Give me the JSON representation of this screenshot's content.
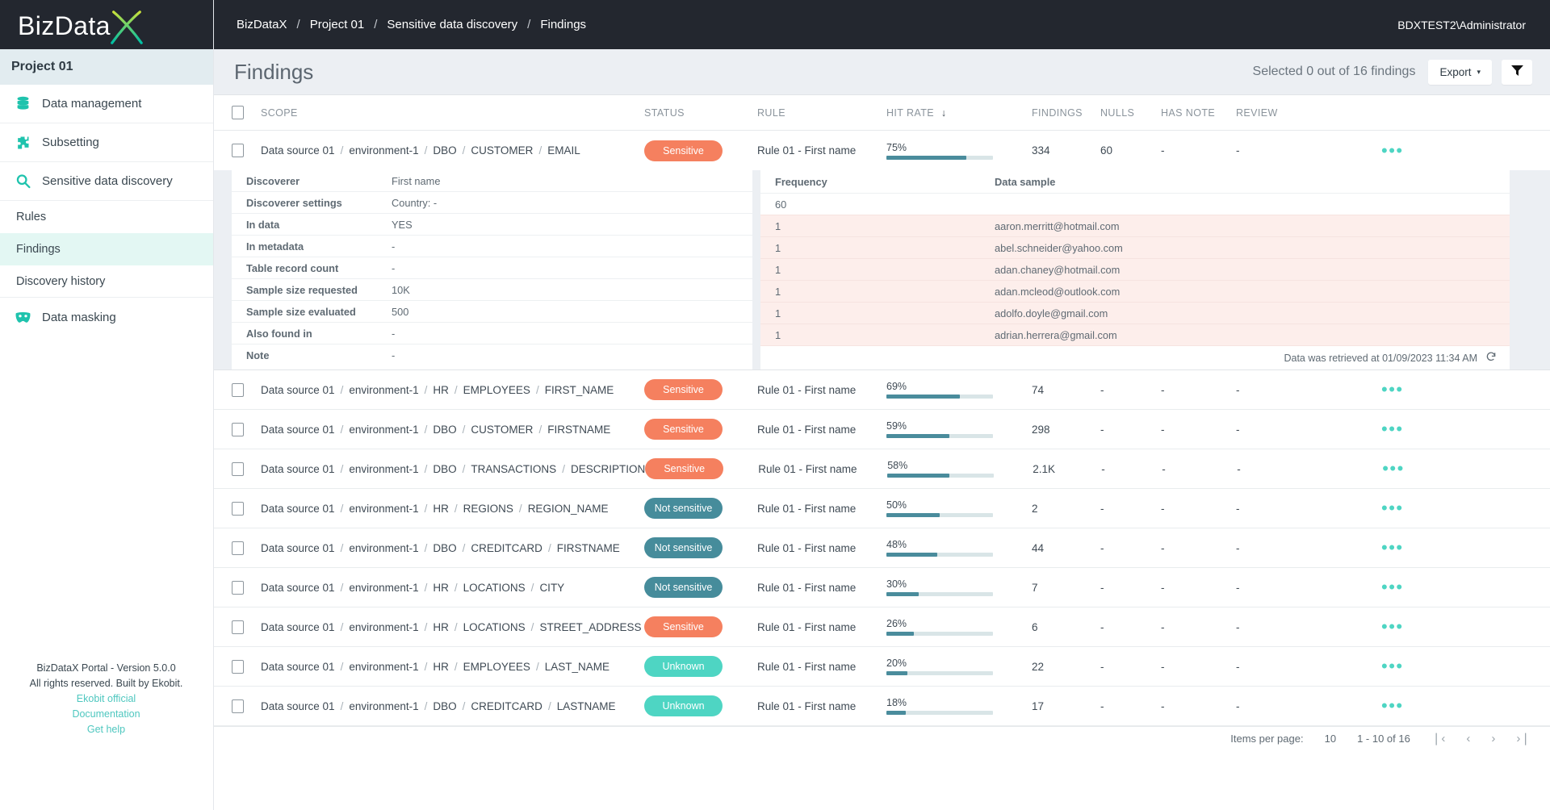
{
  "brand": {
    "logo_text": "BizData",
    "logo_mark": "X"
  },
  "sidebar": {
    "project_label": "Project 01",
    "items": [
      {
        "label": "Data management",
        "icon": "database-icon"
      },
      {
        "label": "Subsetting",
        "icon": "puzzle-icon"
      },
      {
        "label": "Sensitive data discovery",
        "icon": "magnifier-icon"
      }
    ],
    "sub_items": [
      {
        "label": "Rules",
        "active": false
      },
      {
        "label": "Findings",
        "active": true
      },
      {
        "label": "Discovery history",
        "active": false
      }
    ],
    "data_masking": {
      "label": "Data masking",
      "icon": "mask-icon"
    },
    "footer": {
      "version": "BizDataX Portal - Version 5.0.0",
      "rights": "All rights reserved. Built by Ekobit.",
      "links": [
        "Ekobit official",
        "Documentation",
        "Get help"
      ]
    }
  },
  "topbar": {
    "breadcrumbs": [
      "BizDataX",
      "Project 01",
      "Sensitive data discovery",
      "Findings"
    ],
    "separator": "/",
    "user": "BDXTEST2\\Administrator"
  },
  "pagebar": {
    "title": "Findings",
    "selected_text": "Selected 0 out of 16 findings",
    "export_label": "Export",
    "export_caret": "▾",
    "filter_icon": "filter-icon"
  },
  "table": {
    "headers": {
      "scope": "SCOPE",
      "status": "STATUS",
      "rule": "RULE",
      "hit_rate": "HIT RATE",
      "hit_rate_sort": "↓",
      "findings": "FINDINGS",
      "nulls": "NULLS",
      "has_note": "HAS NOTE",
      "review": "REVIEW"
    },
    "rows": [
      {
        "scope": [
          "Data source 01",
          "environment-1",
          "DBO",
          "CUSTOMER",
          "EMAIL"
        ],
        "status": "Sensitive",
        "status_kind": "sensitive",
        "rule": "Rule 01 - First name",
        "hit_rate": "75%",
        "hit_value": 75,
        "findings": "334",
        "nulls": "60",
        "has_note": "-",
        "review": "-",
        "expanded": true
      },
      {
        "scope": [
          "Data source 01",
          "environment-1",
          "HR",
          "EMPLOYEES",
          "FIRST_NAME"
        ],
        "status": "Sensitive",
        "status_kind": "sensitive",
        "rule": "Rule 01 - First name",
        "hit_rate": "69%",
        "hit_value": 69,
        "findings": "74",
        "nulls": "-",
        "has_note": "-",
        "review": "-",
        "expanded": false
      },
      {
        "scope": [
          "Data source 01",
          "environment-1",
          "DBO",
          "CUSTOMER",
          "FIRSTNAME"
        ],
        "status": "Sensitive",
        "status_kind": "sensitive",
        "rule": "Rule 01 - First name",
        "hit_rate": "59%",
        "hit_value": 59,
        "findings": "298",
        "nulls": "-",
        "has_note": "-",
        "review": "-",
        "expanded": false
      },
      {
        "scope": [
          "Data source 01",
          "environment-1",
          "DBO",
          "TRANSACTIONS",
          "DESCRIPTION"
        ],
        "status": "Sensitive",
        "status_kind": "sensitive",
        "rule": "Rule 01 - First name",
        "hit_rate": "58%",
        "hit_value": 58,
        "findings": "2.1K",
        "nulls": "-",
        "has_note": "-",
        "review": "-",
        "expanded": false
      },
      {
        "scope": [
          "Data source 01",
          "environment-1",
          "HR",
          "REGIONS",
          "REGION_NAME"
        ],
        "status": "Not sensitive",
        "status_kind": "not-sensitive",
        "rule": "Rule 01 - First name",
        "hit_rate": "50%",
        "hit_value": 50,
        "findings": "2",
        "nulls": "-",
        "has_note": "-",
        "review": "-",
        "expanded": false
      },
      {
        "scope": [
          "Data source 01",
          "environment-1",
          "DBO",
          "CREDITCARD",
          "FIRSTNAME"
        ],
        "status": "Not sensitive",
        "status_kind": "not-sensitive",
        "rule": "Rule 01 - First name",
        "hit_rate": "48%",
        "hit_value": 48,
        "findings": "44",
        "nulls": "-",
        "has_note": "-",
        "review": "-",
        "expanded": false
      },
      {
        "scope": [
          "Data source 01",
          "environment-1",
          "HR",
          "LOCATIONS",
          "CITY"
        ],
        "status": "Not sensitive",
        "status_kind": "not-sensitive",
        "rule": "Rule 01 - First name",
        "hit_rate": "30%",
        "hit_value": 30,
        "findings": "7",
        "nulls": "-",
        "has_note": "-",
        "review": "-",
        "expanded": false
      },
      {
        "scope": [
          "Data source 01",
          "environment-1",
          "HR",
          "LOCATIONS",
          "STREET_ADDRESS"
        ],
        "status": "Sensitive",
        "status_kind": "sensitive",
        "rule": "Rule 01 - First name",
        "hit_rate": "26%",
        "hit_value": 26,
        "findings": "6",
        "nulls": "-",
        "has_note": "-",
        "review": "-",
        "expanded": false
      },
      {
        "scope": [
          "Data source 01",
          "environment-1",
          "HR",
          "EMPLOYEES",
          "LAST_NAME"
        ],
        "status": "Unknown",
        "status_kind": "unknown",
        "rule": "Rule 01 - First name",
        "hit_rate": "20%",
        "hit_value": 20,
        "findings": "22",
        "nulls": "-",
        "has_note": "-",
        "review": "-",
        "expanded": false
      },
      {
        "scope": [
          "Data source 01",
          "environment-1",
          "DBO",
          "CREDITCARD",
          "LASTNAME"
        ],
        "status": "Unknown",
        "status_kind": "unknown",
        "rule": "Rule 01 - First name",
        "hit_rate": "18%",
        "hit_value": 18,
        "findings": "17",
        "nulls": "-",
        "has_note": "-",
        "review": "-",
        "expanded": false
      }
    ],
    "row_actions_icon": "ellipsis-icon"
  },
  "detail": {
    "properties": [
      {
        "key": "Discoverer",
        "value": "First name"
      },
      {
        "key": "Discoverer settings",
        "value": "Country: -"
      },
      {
        "key": "In data",
        "value": "YES"
      },
      {
        "key": "In metadata",
        "value": "-"
      },
      {
        "key": "Table record count",
        "value": "-"
      },
      {
        "key": "Sample size requested",
        "value": "10K"
      },
      {
        "key": "Sample size evaluated",
        "value": "500"
      },
      {
        "key": "Also found in",
        "value": "-"
      },
      {
        "key": "Note",
        "value": "-"
      }
    ],
    "sample_headers": {
      "frequency": "Frequency",
      "data_sample": "Data sample"
    },
    "samples": [
      {
        "frequency": "60",
        "value": "",
        "highlight": false
      },
      {
        "frequency": "1",
        "value": "aaron.merritt@hotmail.com",
        "highlight": true
      },
      {
        "frequency": "1",
        "value": "abel.schneider@yahoo.com",
        "highlight": true
      },
      {
        "frequency": "1",
        "value": "adan.chaney@hotmail.com",
        "highlight": true
      },
      {
        "frequency": "1",
        "value": "adan.mcleod@outlook.com",
        "highlight": true
      },
      {
        "frequency": "1",
        "value": "adolfo.doyle@gmail.com",
        "highlight": true
      },
      {
        "frequency": "1",
        "value": "adrian.herrera@gmail.com",
        "highlight": true
      }
    ],
    "retrieved_text": "Data was retrieved at 01/09/2023 11:34 AM",
    "refresh_icon": "refresh-icon"
  },
  "pagination": {
    "items_per_page_label": "Items per page:",
    "items_per_page_value": "10",
    "range": "1 - 10 of 16",
    "first_icon": "first-page-icon",
    "prev_icon": "prev-page-icon",
    "next_icon": "next-page-icon",
    "last_icon": "last-page-icon"
  },
  "colors": {
    "dark": "#23272f",
    "teal": "#4ed5c3",
    "sensitive": "#f5805f",
    "not_sensitive": "#468c9b",
    "unknown": "#4ed5c3",
    "bar_fill": "#4a8c9c",
    "bar_track": "#d9e5e7",
    "page_bg": "#eceff3",
    "sample_highlight": "#fdeeeb"
  }
}
